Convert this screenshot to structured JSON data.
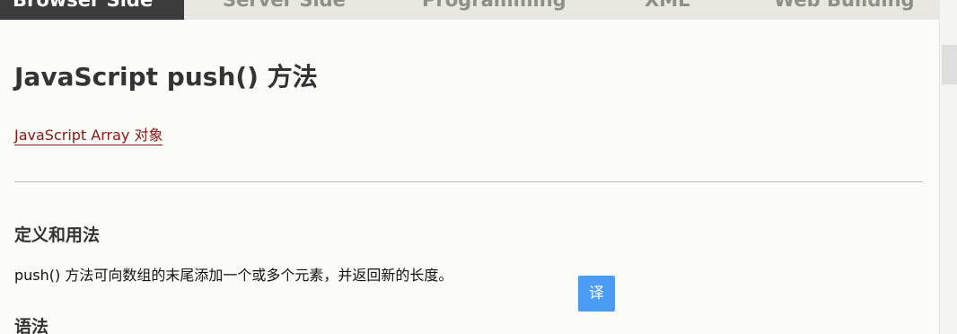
{
  "nav": {
    "tabs": [
      {
        "label": "Browser Side",
        "active": true
      },
      {
        "label": "Server Side",
        "active": false
      },
      {
        "label": "Programming",
        "active": false
      },
      {
        "label": "XML",
        "active": false
      },
      {
        "label": "Web Building",
        "active": false
      }
    ]
  },
  "main": {
    "title": "JavaScript push() 方法",
    "array_link": "JavaScript Array 对象",
    "definition_heading": "定义和用法",
    "definition_text": "push() 方法可向数组的末尾添加一个或多个元素，并返回新的长度。",
    "syntax_heading": "语法"
  },
  "translate_button": {
    "label": "译",
    "color": "#4a9cf6"
  },
  "colors": {
    "page_bg": "#fbfbf7",
    "active_tab_bg": "#3c3c3c",
    "link": "#8b1515"
  }
}
